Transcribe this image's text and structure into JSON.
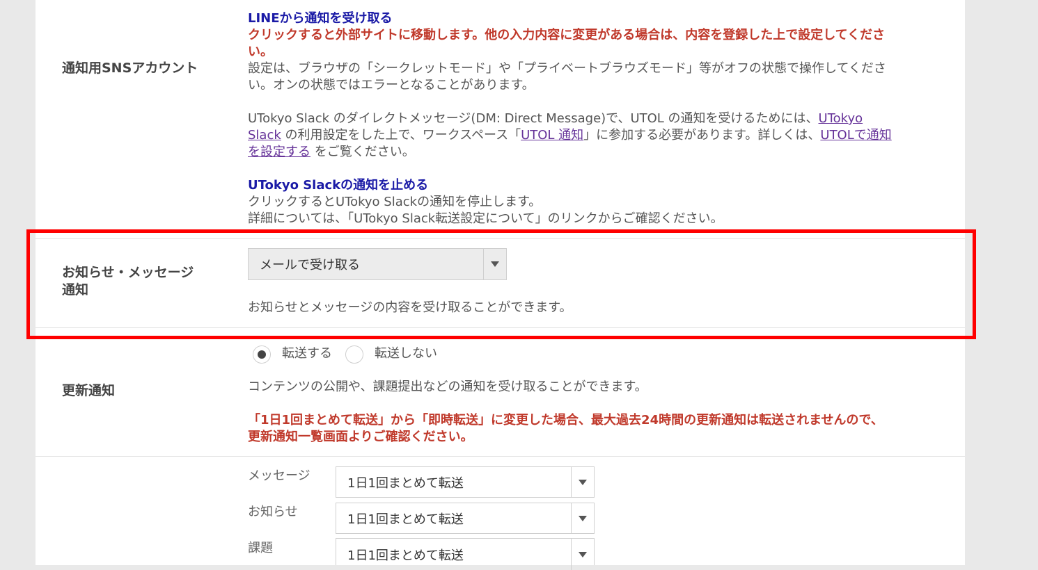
{
  "sns_section": {
    "label": "通知用SNSアカウント",
    "line_link": "LINEから通知を受け取る",
    "line_warning_1": "クリックすると外部サイトに移動します。他の入力内容に変更がある場合は、内容を登録した上で設定してくださ",
    "line_warning_2": "い。",
    "browser_note_1": "設定は、ブラウザの「シークレットモード」や「プライベートブラウズモード」等がオフの状態で操作してくださ",
    "browser_note_2": "い。オンの状態ではエラーとなることがあります。",
    "slack_para_1_pre": "UTokyo Slack のダイレクトメッセージ(DM: Direct Message)で、UTOL の通知を受けるためには、",
    "slack_link_1a": "UTokyo",
    "slack_link_1b": "Slack",
    "slack_para_2_mid": " の利用設定をした上で、ワークスペース「",
    "slack_link_2": "UTOL 通知",
    "slack_para_2_post": "」に参加する必要があります。詳しくは、",
    "slack_link_3a": "UTOLで通知",
    "slack_link_3b": "を設定する",
    "slack_para_3_post": " をご覧ください。",
    "slack_stop_link": "UTokyo Slackの通知を止める",
    "slack_stop_note_1": "クリックするとUTokyo Slackの通知を停止します。",
    "slack_stop_note_2": "詳細については、「UTokyo Slack転送設定について」のリンクからご確認ください。"
  },
  "notice_section": {
    "label": "お知らせ・メッセージ通知",
    "select_value": "メールで受け取る",
    "description": "お知らせとメッセージの内容を受け取ることができます。"
  },
  "update_section": {
    "label": "更新通知",
    "radio_on": "転送する",
    "radio_off": "転送しない",
    "description": "コンテンツの公開や、課題提出などの通知を受け取ることができます。",
    "warning_1": "「1日1回まとめて転送」から「即時転送」に変更した場合、最大過去24時間の更新通知は転送されませんので、",
    "warning_2": "更新通知一覧画面よりご確認ください。"
  },
  "update_options": [
    {
      "label": "メッセージ",
      "value": "1日1回まとめて転送"
    },
    {
      "label": "お知らせ",
      "value": "1日1回まとめて転送"
    },
    {
      "label": "課題",
      "value": "1日1回まとめて転送"
    }
  ],
  "colors": {
    "highlight": "#ff0000",
    "link": "#1a1aa6",
    "warning": "#c0392b",
    "visited_link": "#663399"
  }
}
